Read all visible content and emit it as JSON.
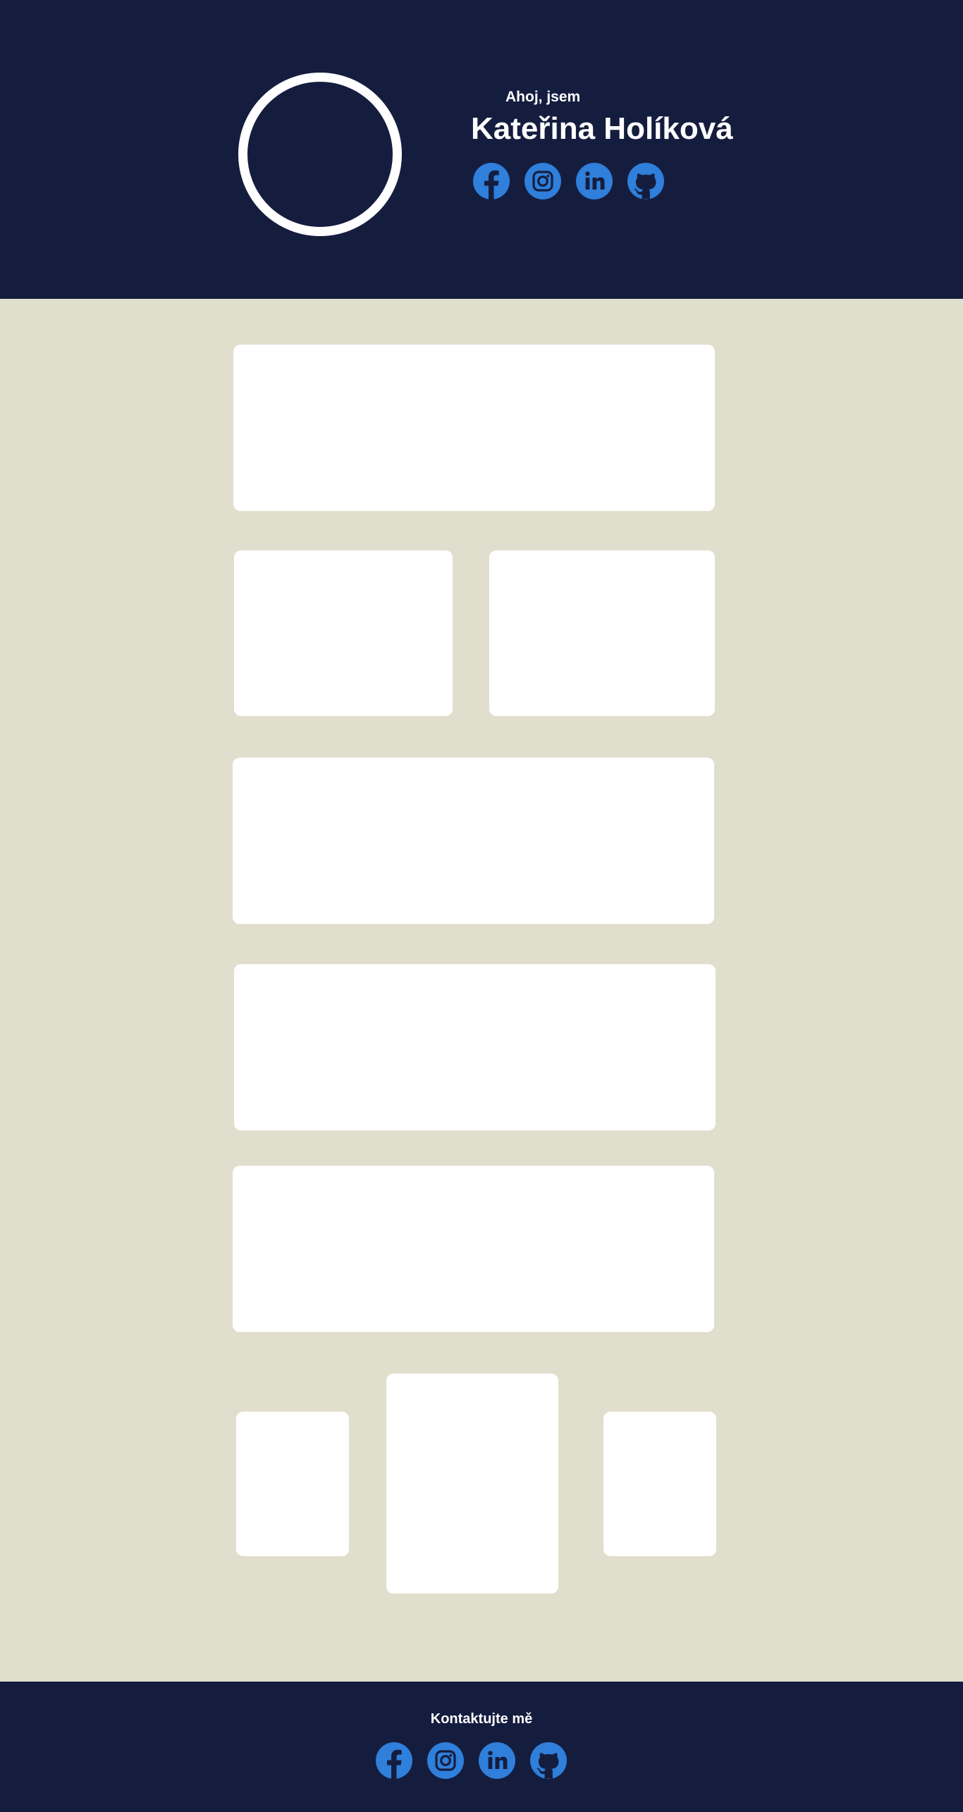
{
  "header": {
    "greeting": "Ahoj, jsem",
    "name": "Kateřina Holíková"
  },
  "social_icons": [
    "facebook-icon",
    "instagram-icon",
    "linkedin-icon",
    "github-icon"
  ],
  "footer": {
    "contact_label": "Kontaktujte mě"
  },
  "colors": {
    "navy": "#151d3f",
    "background": "#e0dfce",
    "accent_blue": "#2f7fdb",
    "card": "#ffffff"
  }
}
